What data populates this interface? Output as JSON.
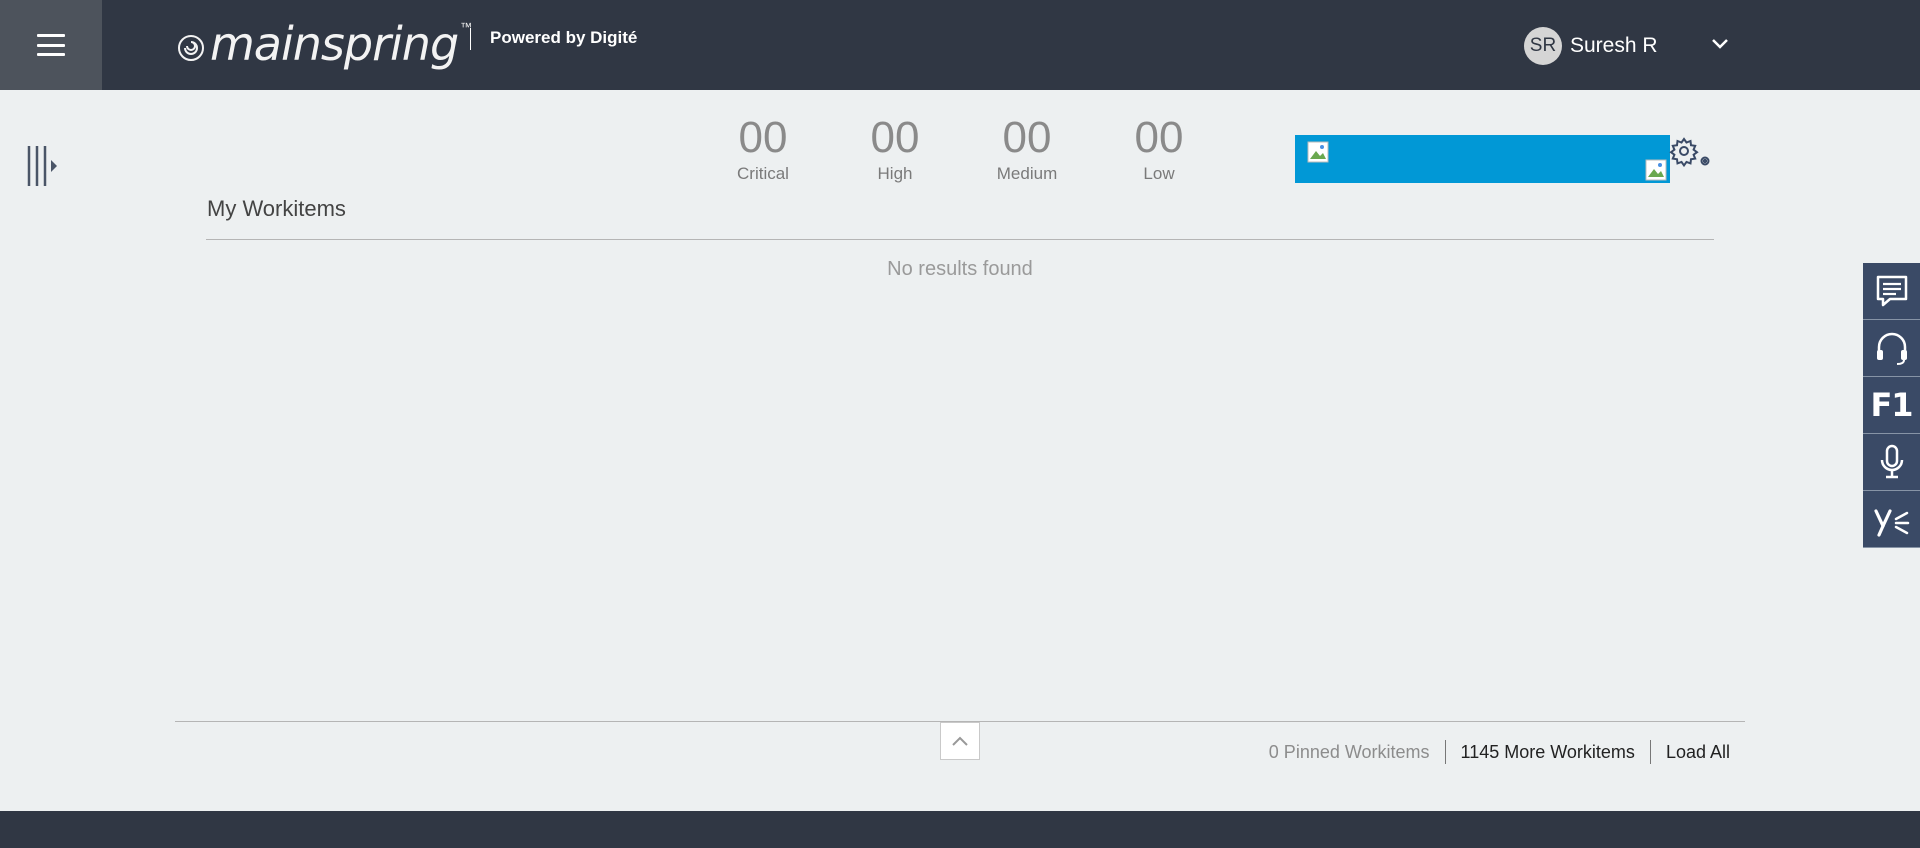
{
  "header": {
    "brand": "mainspring",
    "trademark": "™",
    "powered_by": "Powered by Digité",
    "user": {
      "initials": "SR",
      "name": "Suresh R"
    }
  },
  "counters": [
    {
      "value": "00",
      "label": "Critical"
    },
    {
      "value": "00",
      "label": "High"
    },
    {
      "value": "00",
      "label": "Medium"
    },
    {
      "value": "00",
      "label": "Low"
    }
  ],
  "workitems": {
    "title": "My Workitems",
    "empty_message": "No results found"
  },
  "footer_bar": {
    "pinned": "0 Pinned Workitems",
    "more": "1145 More Workitems",
    "load_all": "Load All"
  },
  "side_tools": {
    "f1_label": "F1",
    "items": [
      "chat-icon",
      "headset-icon",
      "f1-help",
      "microphone-icon",
      "yammer-icon"
    ]
  },
  "colors": {
    "header_bg": "#303744",
    "banner": "#0198d6",
    "side_tool_bg": "#3a4a66",
    "page_bg": "#edf0f1"
  }
}
